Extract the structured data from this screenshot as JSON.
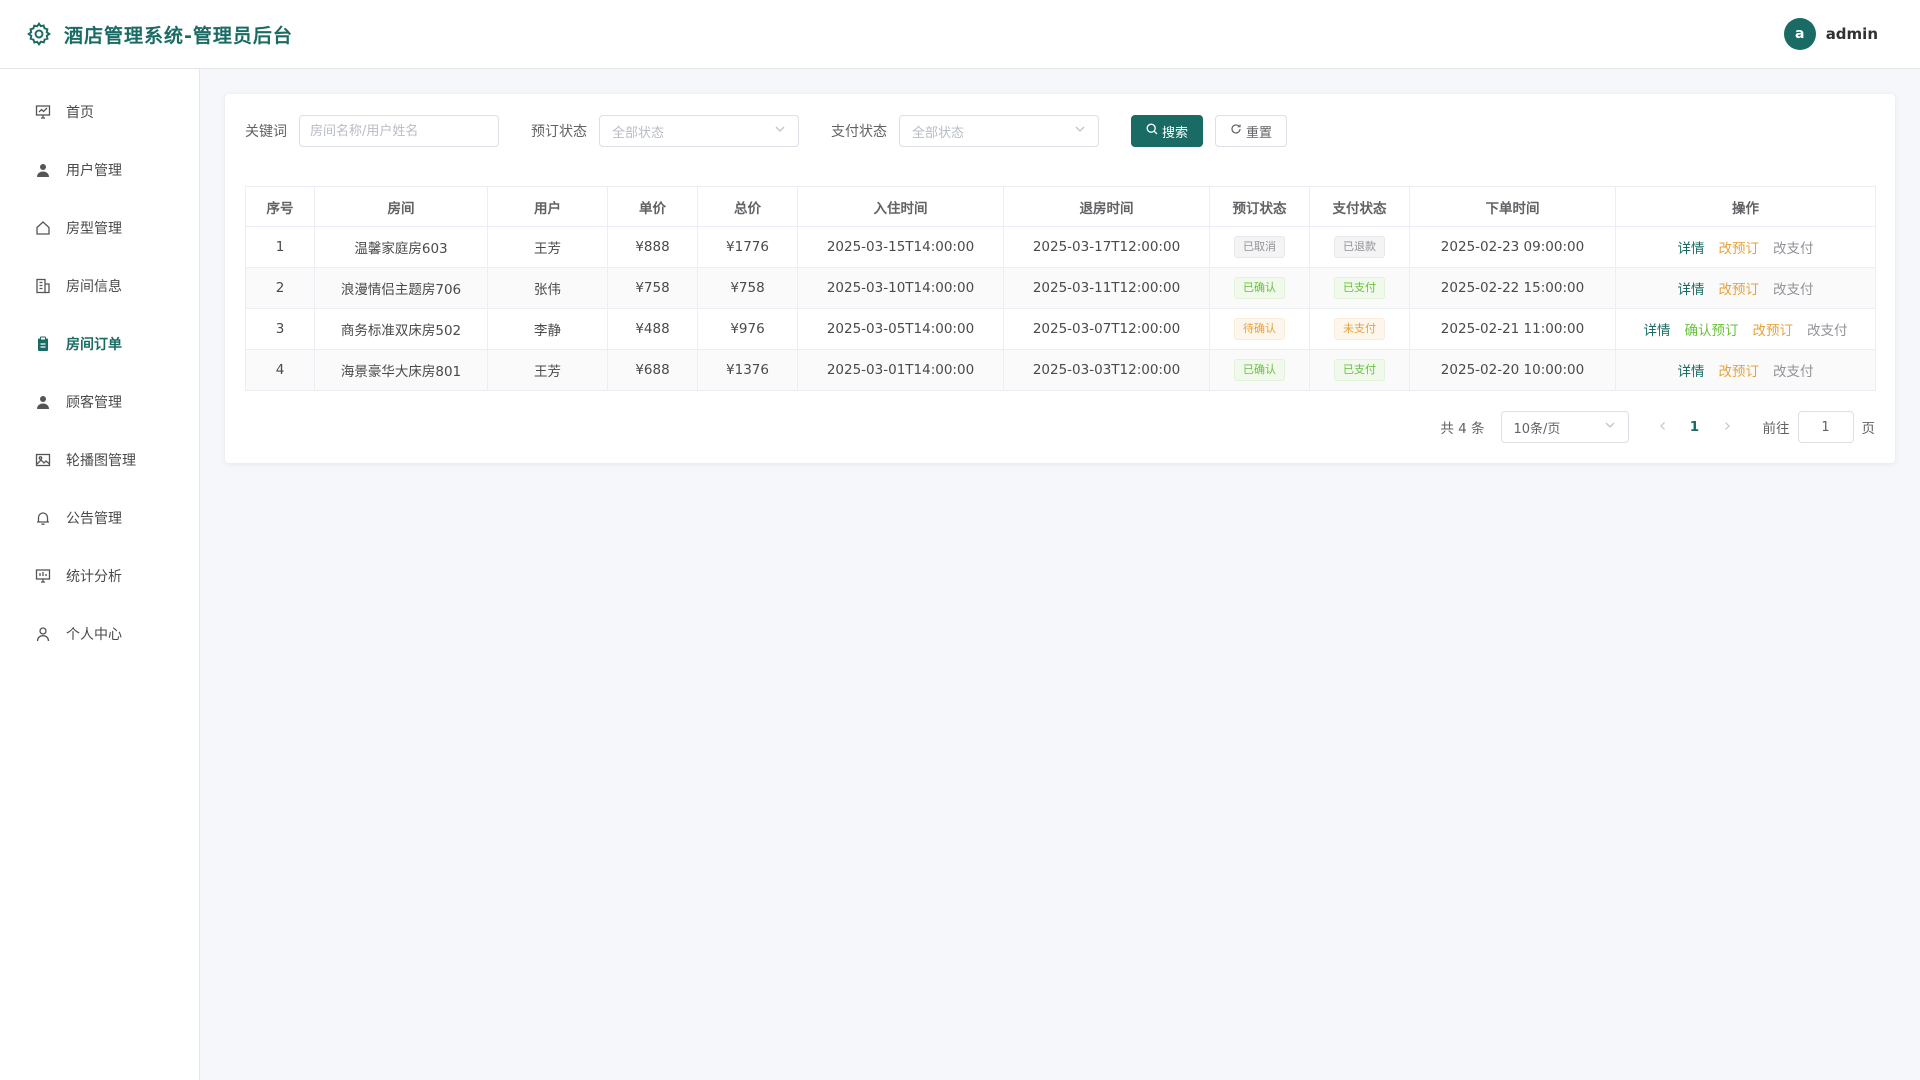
{
  "header": {
    "title": "酒店管理系统-管理员后台",
    "avatar_letter": "a",
    "username": "admin"
  },
  "sidebar": {
    "items": [
      {
        "label": "首页",
        "icon": "dashboard-icon"
      },
      {
        "label": "用户管理",
        "icon": "user-icon"
      },
      {
        "label": "房型管理",
        "icon": "house-icon"
      },
      {
        "label": "房间信息",
        "icon": "building-icon"
      },
      {
        "label": "房间订单",
        "icon": "clipboard-icon",
        "active": true
      },
      {
        "label": "顾客管理",
        "icon": "user-icon"
      },
      {
        "label": "轮播图管理",
        "icon": "image-icon"
      },
      {
        "label": "公告管理",
        "icon": "bell-icon"
      },
      {
        "label": "统计分析",
        "icon": "chart-icon"
      },
      {
        "label": "个人中心",
        "icon": "person-icon"
      }
    ]
  },
  "filters": {
    "keyword_label": "关键词",
    "keyword_placeholder": "房间名称/用户姓名",
    "booking_status_label": "预订状态",
    "booking_status_value": "全部状态",
    "pay_status_label": "支付状态",
    "pay_status_value": "全部状态",
    "search_label": "搜索",
    "reset_label": "重置"
  },
  "table": {
    "headers": [
      "序号",
      "房间",
      "用户",
      "单价",
      "总价",
      "入住时间",
      "退房时间",
      "预订状态",
      "支付状态",
      "下单时间",
      "操作"
    ],
    "rows": [
      {
        "index": "1",
        "room": "温馨家庭房603",
        "user": "王芳",
        "unit_price": "¥888",
        "total": "¥1776",
        "checkin": "2025-03-15T14:00:00",
        "checkout": "2025-03-17T12:00:00",
        "booking_status": "已取消",
        "pay_status": "已退款",
        "order_time": "2025-02-23 09:00:00",
        "actions": [
          "详情",
          "改预订",
          "改支付"
        ]
      },
      {
        "index": "2",
        "room": "浪漫情侣主题房706",
        "user": "张伟",
        "unit_price": "¥758",
        "total": "¥758",
        "checkin": "2025-03-10T14:00:00",
        "checkout": "2025-03-11T12:00:00",
        "booking_status": "已确认",
        "pay_status": "已支付",
        "order_time": "2025-02-22 15:00:00",
        "actions": [
          "详情",
          "改预订",
          "改支付"
        ]
      },
      {
        "index": "3",
        "room": "商务标准双床房502",
        "user": "李静",
        "unit_price": "¥488",
        "total": "¥976",
        "checkin": "2025-03-05T14:00:00",
        "checkout": "2025-03-07T12:00:00",
        "booking_status": "待确认",
        "pay_status": "未支付",
        "order_time": "2025-02-21 11:00:00",
        "actions": [
          "详情",
          "确认预订",
          "改预订",
          "改支付"
        ]
      },
      {
        "index": "4",
        "room": "海景豪华大床房801",
        "user": "王芳",
        "unit_price": "¥688",
        "total": "¥1376",
        "checkin": "2025-03-01T14:00:00",
        "checkout": "2025-03-03T12:00:00",
        "booking_status": "已确认",
        "pay_status": "已支付",
        "order_time": "2025-02-20 10:00:00",
        "actions": [
          "详情",
          "改预订",
          "改支付"
        ]
      }
    ]
  },
  "pagination": {
    "total_text": "共 4 条",
    "page_size": "10条/页",
    "current_page": "1",
    "goto_label": "前往",
    "goto_value": "1",
    "page_suffix": "页"
  },
  "colors": {
    "primary": "#1a6b63",
    "success": "#67c23a",
    "warning": "#e6a23c",
    "info": "#909399"
  }
}
